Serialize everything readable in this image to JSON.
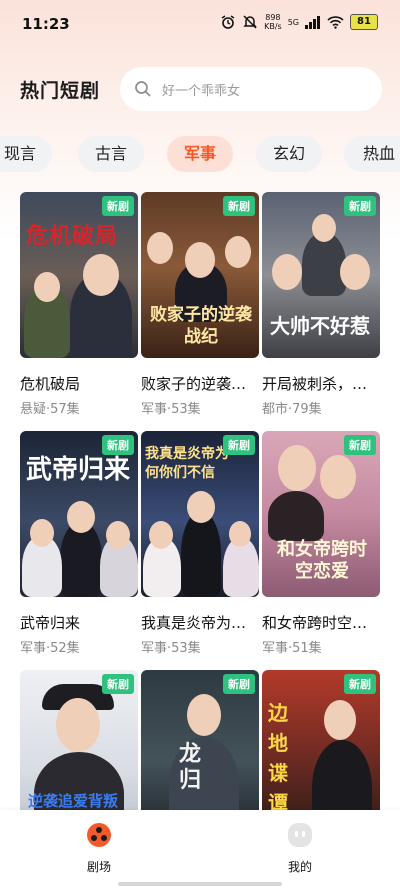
{
  "status": {
    "time": "11:23",
    "speed_value": "898",
    "speed_unit": "KB/s",
    "network": "5G",
    "battery": "81"
  },
  "header": {
    "title": "热门短剧",
    "search_placeholder": "好一个乖乖女"
  },
  "tabs": [
    "现言",
    "古言",
    "军事",
    "玄幻",
    "热血"
  ],
  "active_tab": "军事",
  "badge_label": "新剧",
  "dramas": [
    {
      "name": "危机破局",
      "meta": "悬疑·57集",
      "poster_text": "危机破局"
    },
    {
      "name": "败家子的逆袭…",
      "meta": "军事·53集",
      "poster_text": "败家子的逆袭战纪"
    },
    {
      "name": "开局被刺杀，…",
      "meta": "都市·79集",
      "poster_text": "大帅不好惹"
    },
    {
      "name": "武帝归来",
      "meta": "军事·52集",
      "poster_text": "武帝归来"
    },
    {
      "name": "我真是炎帝为…",
      "meta": "军事·53集",
      "poster_text": "我真是炎帝为何你们不信"
    },
    {
      "name": "和女帝跨时空…",
      "meta": "军事·51集",
      "poster_text": "和女帝跨时空恋爱"
    },
    {
      "name": "",
      "meta": "",
      "poster_text": "逆袭追爱背叛"
    },
    {
      "name": "",
      "meta": "",
      "poster_text": "龙归"
    },
    {
      "name": "",
      "meta": "",
      "poster_text": "边地谍谭"
    }
  ],
  "nav": {
    "theater": "剧场",
    "mine": "我的"
  },
  "colors": {
    "accent": "#f25a2a",
    "badge": "#2ec27e",
    "active_tab_bg": "#fde0d5"
  }
}
